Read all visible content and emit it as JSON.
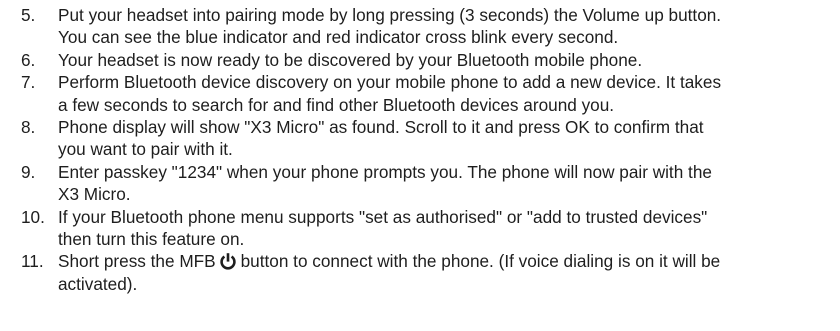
{
  "steps": [
    {
      "num": "5.",
      "lines": [
        "Put your headset into pairing mode by long pressing (3 seconds) the Volume up button.",
        "You can see the blue indicator and red indicator cross blink every second."
      ]
    },
    {
      "num": "6.",
      "lines": [
        "Your headset is now ready to be discovered by your Bluetooth mobile phone."
      ]
    },
    {
      "num": "7.",
      "lines": [
        "Perform Bluetooth device discovery on your mobile phone to add a new device. It takes",
        "a few seconds to search for and find other Bluetooth devices around you."
      ]
    },
    {
      "num": "8.",
      "lines": [
        "Phone display will show \"X3 Micro\" as found. Scroll to it and press OK to confirm that",
        "you want to pair with it."
      ]
    },
    {
      "num": "9.",
      "lines": [
        "Enter passkey \"1234\" when your phone prompts you. The phone will now pair with the",
        "X3 Micro."
      ]
    },
    {
      "num": "10.",
      "lines": [
        "If your Bluetooth phone menu supports \"set as authorised\" or \"add to trusted devices\"",
        "then turn this feature on."
      ]
    },
    {
      "num": "11.",
      "line1_before": "Short press the MFB",
      "icon": "power-icon",
      "line1_after": "button to connect with the phone. (If voice dialing is on it will be",
      "line2": "activated)."
    }
  ]
}
